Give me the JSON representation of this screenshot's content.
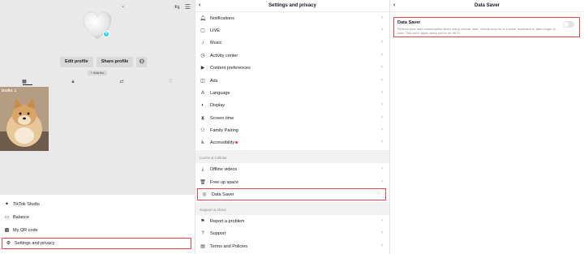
{
  "left": {
    "username_chevron": "⌄",
    "buttons": {
      "edit_profile": "Edit profile",
      "share_profile": "Share profile"
    },
    "add_bio": "+ Add bio",
    "thumbnail_label": "Drafts: 1",
    "menu": [
      {
        "label": "TikTok Studio",
        "icon": "studio-icon"
      },
      {
        "label": "Balance",
        "icon": "wallet-icon"
      },
      {
        "label": "My QR code",
        "icon": "qr-icon"
      },
      {
        "label": "Settings and privacy",
        "icon": "gear-icon"
      }
    ]
  },
  "middle": {
    "title": "Settings and privacy",
    "items": [
      {
        "label": "Notifications",
        "icon": "bell-icon"
      },
      {
        "label": "LIVE",
        "icon": "live-icon"
      },
      {
        "label": "Music",
        "icon": "music-icon"
      },
      {
        "label": "Activity center",
        "icon": "clock-icon"
      },
      {
        "label": "Content preferences",
        "icon": "video-icon"
      },
      {
        "label": "Ads",
        "icon": "ads-icon"
      },
      {
        "label": "Language",
        "icon": "language-icon"
      },
      {
        "label": "Display",
        "icon": "display-icon"
      },
      {
        "label": "Screen time",
        "icon": "hourglass-icon"
      },
      {
        "label": "Family Pairing",
        "icon": "family-icon"
      },
      {
        "label": "Accessibility",
        "icon": "accessibility-icon"
      }
    ],
    "section_cache": "Cache & Cellular",
    "cache_items": [
      {
        "label": "Offline videos",
        "icon": "download-icon"
      },
      {
        "label": "Free up space",
        "icon": "trash-icon"
      },
      {
        "label": "Data Saver",
        "icon": "data-icon"
      }
    ],
    "section_support": "Support & About",
    "support_items": [
      {
        "label": "Report a problem",
        "icon": "flag-icon"
      },
      {
        "label": "Support",
        "icon": "support-icon"
      },
      {
        "label": "Terms and Policies",
        "icon": "document-icon"
      }
    ]
  },
  "right": {
    "title": "Data Saver",
    "option_title": "Data Saver",
    "option_desc": "Reduce your data consumption when using cellular data. Videos may be of a lower resolution or take longer to load. This won't apply when you're on Wi-Fi.",
    "toggle_on": false
  },
  "icons": {
    "back": "‹",
    "chevron": "›"
  },
  "colors": {
    "highlight": "#e8474b",
    "accent": "#20d5ec",
    "notification_dot": "#fe2c55"
  }
}
